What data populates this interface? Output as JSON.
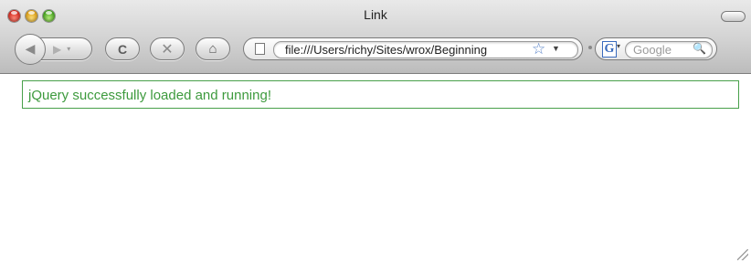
{
  "window": {
    "title": "Link"
  },
  "toolbar": {
    "back_icon": "back-arrow-icon",
    "forward_icon": "forward-arrow-icon",
    "reload_icon": "reload-icon",
    "stop_icon": "stop-icon",
    "home_icon": "home-icon",
    "back_glyph": "◀",
    "forward_glyph": "▶",
    "history_glyph": "▾",
    "reload_glyph": "C",
    "stop_glyph": "✕",
    "home_glyph": "⌂"
  },
  "address_bar": {
    "url": "file:///Users/richy/Sites/wrox/Beginning",
    "bookmark_glyph": "☆",
    "dropdown_glyph": "▼"
  },
  "search": {
    "engine_glyph": "G",
    "engine_drop_glyph": "▾",
    "placeholder": "Google",
    "search_glyph": "🔍"
  },
  "content": {
    "message": "jQuery successfully loaded and running!",
    "message_color": "#3d9a3d",
    "border_color": "#48a04a"
  }
}
